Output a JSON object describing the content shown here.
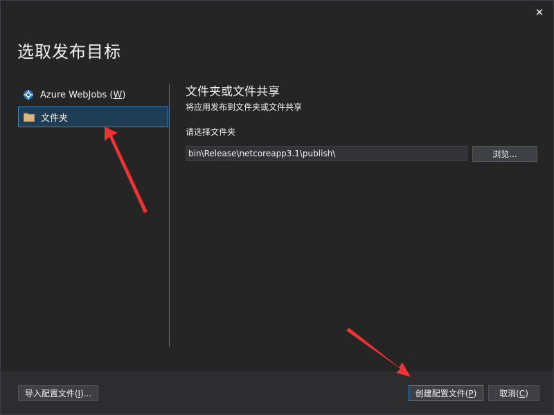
{
  "dialog": {
    "title": "选取发布目标",
    "close_glyph": "✕"
  },
  "sidebar": {
    "items": [
      {
        "label_prefix": "Azure WebJobs (",
        "mnemonic": "W",
        "label_suffix": ")",
        "icon": "azure-webjobs-icon",
        "selected": false
      },
      {
        "label": "文件夹",
        "icon": "folder-icon",
        "selected": true
      }
    ]
  },
  "main": {
    "title": "文件夹或文件共享",
    "subtitle": "将应用发布到文件夹或文件共享",
    "folder_label": "请选择文件夹",
    "folder_path": "bin\\Release\\netcoreapp3.1\\publish\\",
    "browse_label": "浏览..."
  },
  "footer": {
    "import_prefix": "导入配置文件(",
    "import_mnemonic": "I",
    "import_suffix": ")...",
    "create_prefix": "创建配置文件(",
    "create_mnemonic": "P",
    "create_suffix": ")",
    "cancel_prefix": "取消(",
    "cancel_mnemonic": "C",
    "cancel_suffix": ")"
  },
  "colors": {
    "background": "#252526",
    "footer": "#2d2d30",
    "selection": "#1f3e55",
    "selection_border": "#3b86c3",
    "annotation_arrow": "#ee3333"
  }
}
